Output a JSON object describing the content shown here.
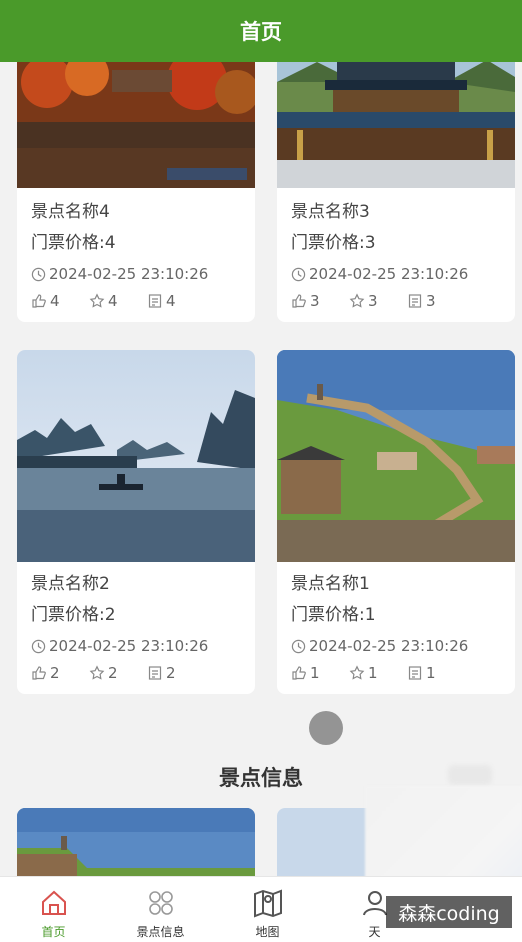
{
  "header": {
    "title": "首页"
  },
  "cards": [
    {
      "name": "景点名称4",
      "price": "门票价格:4",
      "time": "2024-02-25 23:10:26",
      "likes": "4",
      "stars": "4",
      "views": "4"
    },
    {
      "name": "景点名称3",
      "price": "门票价格:3",
      "time": "2024-02-25 23:10:26",
      "likes": "3",
      "stars": "3",
      "views": "3"
    },
    {
      "name": "景点名称2",
      "price": "门票价格:2",
      "time": "2024-02-25 23:10:26",
      "likes": "2",
      "stars": "2",
      "views": "2"
    },
    {
      "name": "景点名称1",
      "price": "门票价格:1",
      "time": "2024-02-25 23:10:26",
      "likes": "1",
      "stars": "1",
      "views": "1"
    }
  ],
  "section": {
    "title": "景点信息"
  },
  "tabs": [
    {
      "label": "首页",
      "icon": "home-icon",
      "active": true
    },
    {
      "label": "景点信息",
      "icon": "grid-icon",
      "active": false
    },
    {
      "label": "地图",
      "icon": "map-icon",
      "active": false
    },
    {
      "label": "天",
      "icon": "person-icon",
      "active": false
    }
  ],
  "watermark": "森森coding",
  "colors": {
    "brand": "#4a9a2a",
    "background": "#f2f2f2"
  }
}
